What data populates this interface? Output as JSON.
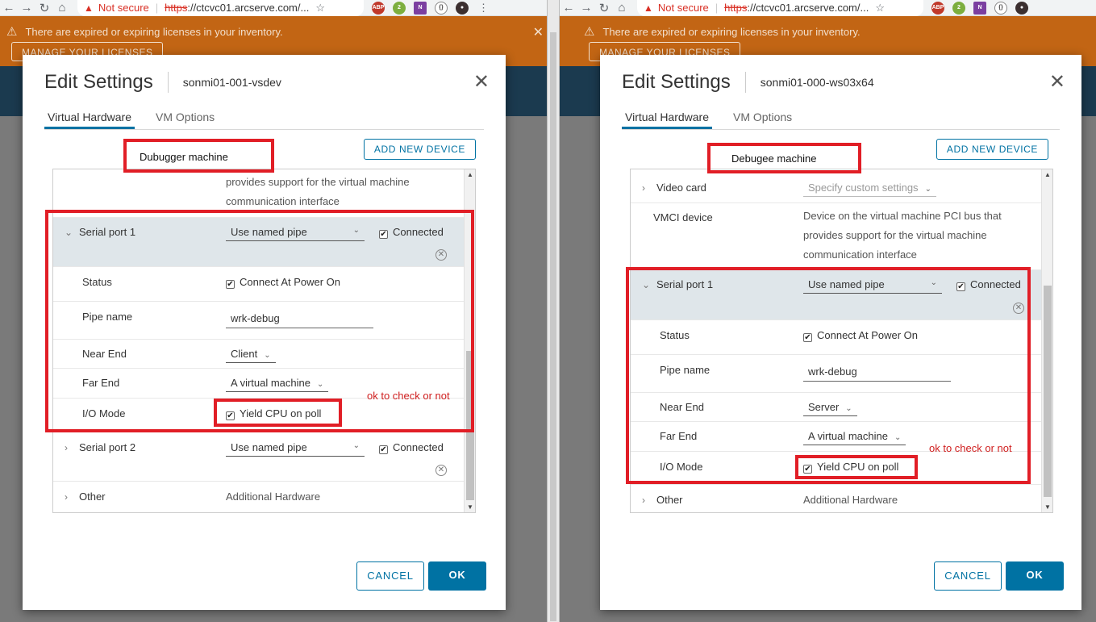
{
  "browser": {
    "not_secure": "Not secure",
    "url_scheme": "https",
    "url_rest": "://ctcvc01.arcserve.com/..."
  },
  "banner": {
    "message": "There are expired or expiring licenses in your inventory.",
    "manage_button": "MANAGE YOUR LICENSES"
  },
  "left": {
    "title": "Edit Settings",
    "vm_name": "sonmi01-001-vsdev",
    "tabs": [
      "Virtual Hardware",
      "VM Options"
    ],
    "add_device": "ADD NEW DEVICE",
    "annotation": "Dubugger machine",
    "ok_note": "ok to check or not",
    "vmci_desc": [
      "provides support for the virtual machine",
      "communication interface"
    ],
    "serial1": {
      "label": "Serial port 1",
      "type": "Use named pipe",
      "connected": "Connected",
      "status_label": "Status",
      "status_value": "Connect At Power On",
      "pipe_label": "Pipe name",
      "pipe_value": "wrk-debug",
      "near_label": "Near End",
      "near_value": "Client",
      "far_label": "Far End",
      "far_value": "A virtual machine",
      "io_label": "I/O Mode",
      "io_value": "Yield CPU on poll"
    },
    "serial2": {
      "label": "Serial port 2",
      "type": "Use named pipe",
      "connected": "Connected"
    },
    "other": {
      "label": "Other",
      "value": "Additional Hardware"
    },
    "cancel": "CANCEL",
    "ok": "OK"
  },
  "right": {
    "title": "Edit Settings",
    "vm_name": "sonmi01-000-ws03x64",
    "tabs": [
      "Virtual Hardware",
      "VM Options"
    ],
    "add_device": "ADD NEW DEVICE",
    "annotation": "Debugee machine",
    "ok_note": "ok to check or not",
    "video": {
      "label": "Video card",
      "value": "Specify custom settings"
    },
    "vmci": {
      "label": "VMCI device",
      "desc": [
        "Device on the virtual machine PCI bus that",
        "provides support for the virtual machine",
        "communication interface"
      ]
    },
    "serial1": {
      "label": "Serial port 1",
      "type": "Use named pipe",
      "connected": "Connected",
      "status_label": "Status",
      "status_value": "Connect At Power On",
      "pipe_label": "Pipe name",
      "pipe_value": "wrk-debug",
      "near_label": "Near End",
      "near_value": "Server",
      "far_label": "Far End",
      "far_value": "A virtual machine",
      "io_label": "I/O Mode",
      "io_value": "Yield CPU on poll"
    },
    "other": {
      "label": "Other",
      "value": "Additional Hardware"
    },
    "cancel": "CANCEL",
    "ok": "OK"
  }
}
